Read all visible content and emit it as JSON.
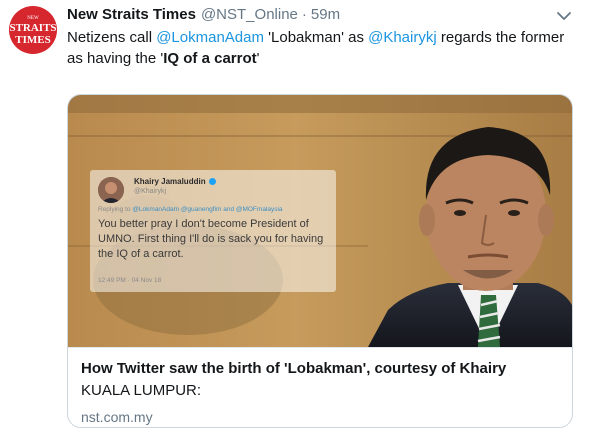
{
  "tweet": {
    "display_name": "New Straits Times",
    "handle": "@NST_Online",
    "separator": "·",
    "time": "59m",
    "avatar_text": [
      "NEW",
      "STRAITS",
      "TIMES"
    ],
    "text": {
      "part1": "Netizens call ",
      "mention1": "@LokmanAdam",
      "part2": " 'Lobakman' as ",
      "mention2": "@Khairykj",
      "part3": " regards the former as having the '",
      "bold": "IQ of a carrot",
      "part4": "'"
    }
  },
  "card": {
    "title": "How Twitter saw the birth of 'Lobakman', courtesy of Khairy",
    "description": "KUALA LUMPUR:",
    "domain": "nst.com.my",
    "embedded_tweet": {
      "name": "Khairy Jamaluddin",
      "handle": "@Khairykj",
      "reply_prefix": "Replying to ",
      "reply_mentions": "@LokmanAdam @guanengfim and @MOFmalaysia",
      "text": "You better pray I don't become President of UMNO. First thing I'll do is sack you for having the IQ of a carrot.",
      "time": "12:49 PM · 04 Nov 18"
    }
  },
  "colors": {
    "link": "#1b95e0",
    "secondary": "#657786",
    "avatar_red": "#d6272f",
    "border": "#ccd6dd"
  }
}
